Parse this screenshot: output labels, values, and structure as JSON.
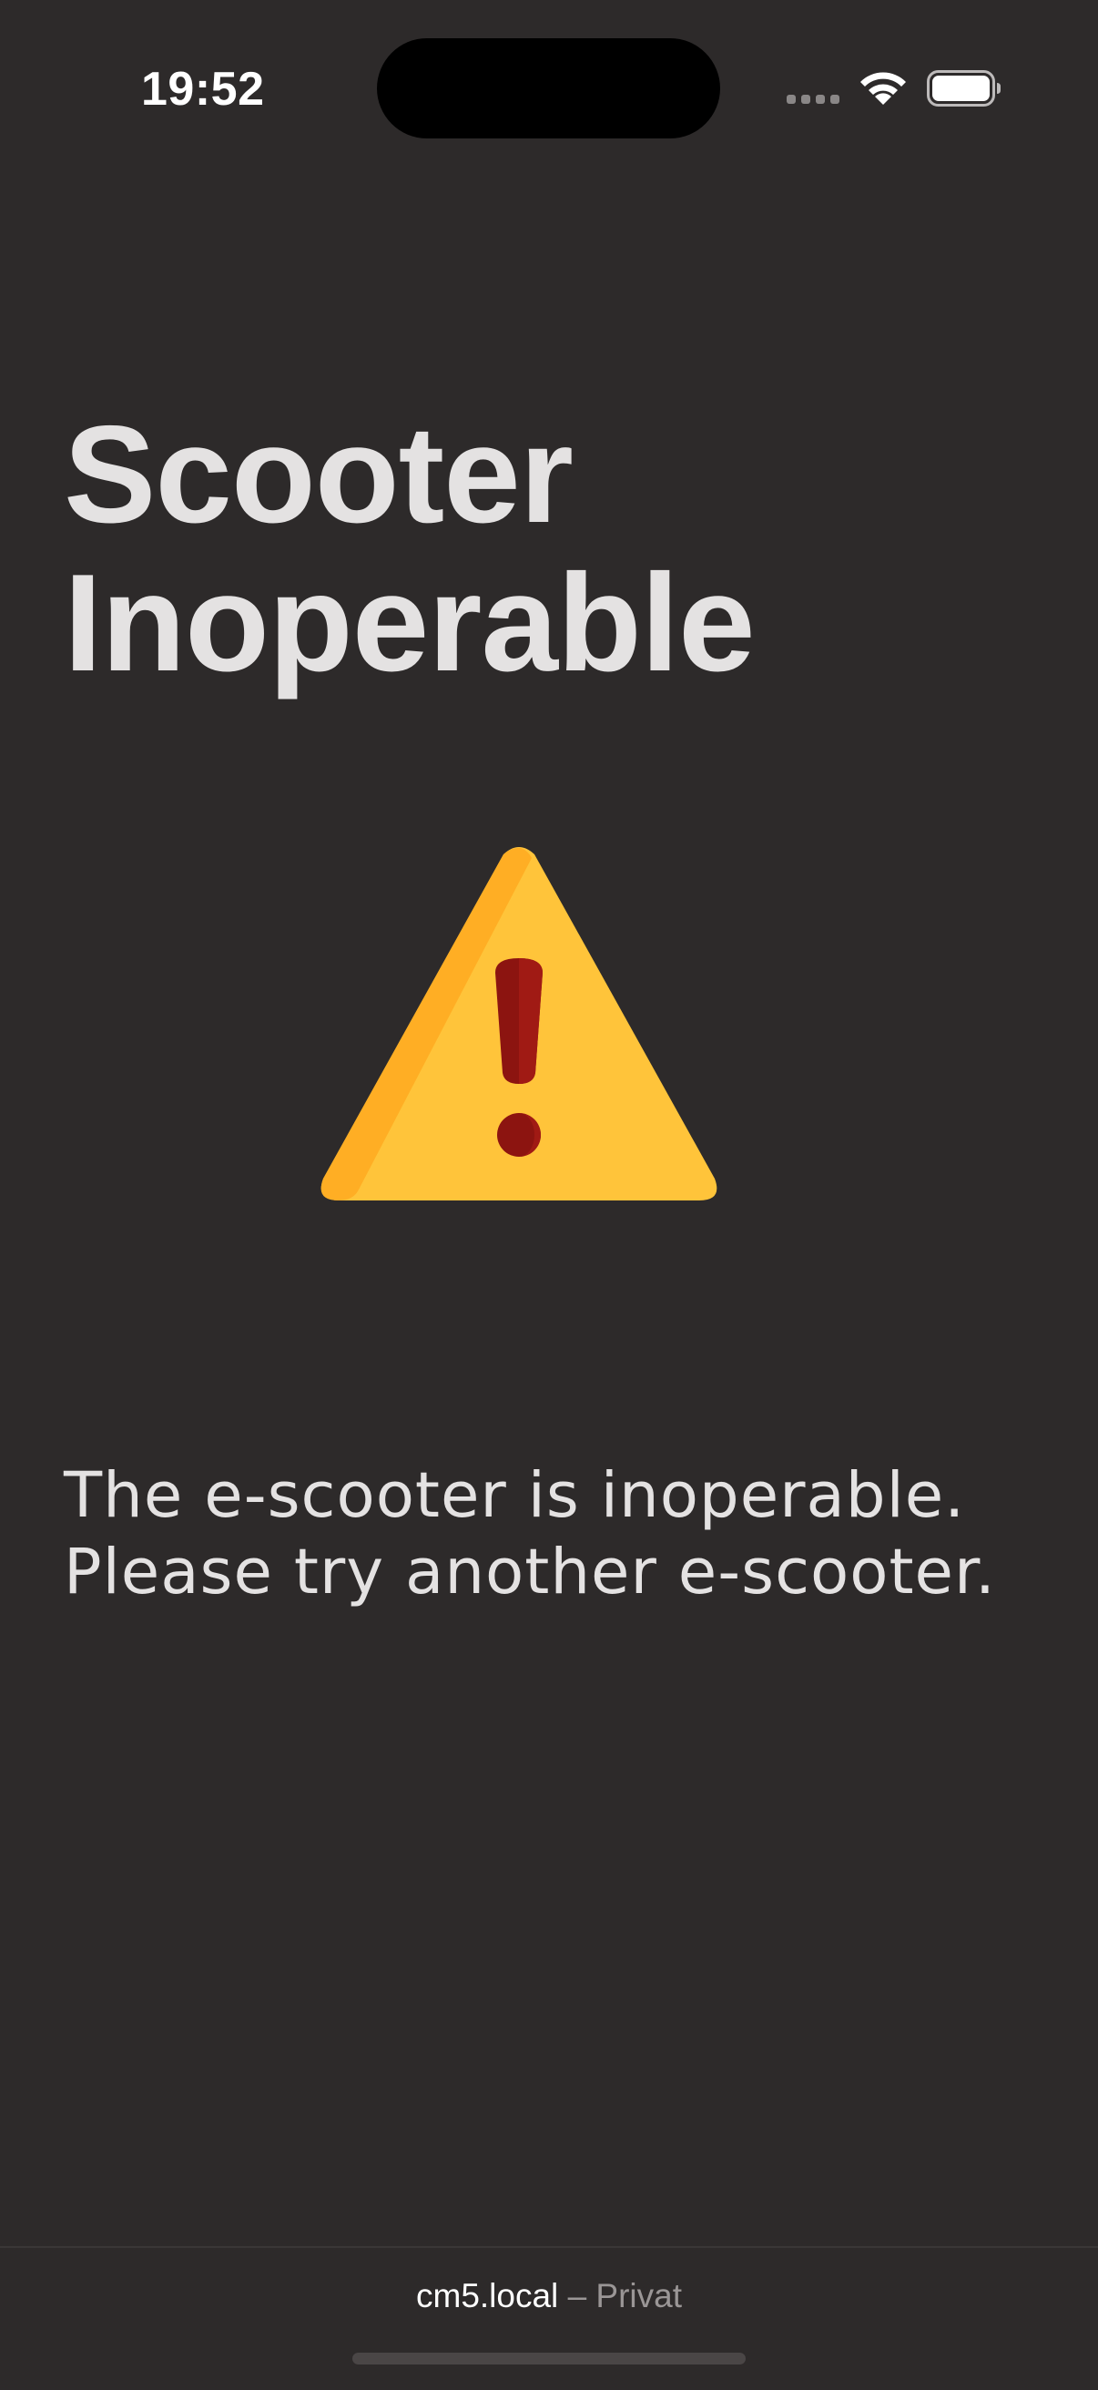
{
  "status_bar": {
    "time": "19:52",
    "icons": [
      "cellular-signal-icon",
      "wifi-icon",
      "battery-icon"
    ]
  },
  "page": {
    "title_line1": "Scooter",
    "title_line2": "Inoperable",
    "icon": "warning-icon",
    "message_line1": "The e-scooter is inoperable.",
    "message_line2": "Please try another e-scooter."
  },
  "browser": {
    "host": "cm5.local",
    "separator": "–",
    "mode": "Privat"
  },
  "colors": {
    "background": "#2d2a2a",
    "text": "#e4e2e2",
    "warning_yellow": "#ffc43a",
    "warning_orange": "#ffae24",
    "exclamation_red": "#8c1410"
  }
}
